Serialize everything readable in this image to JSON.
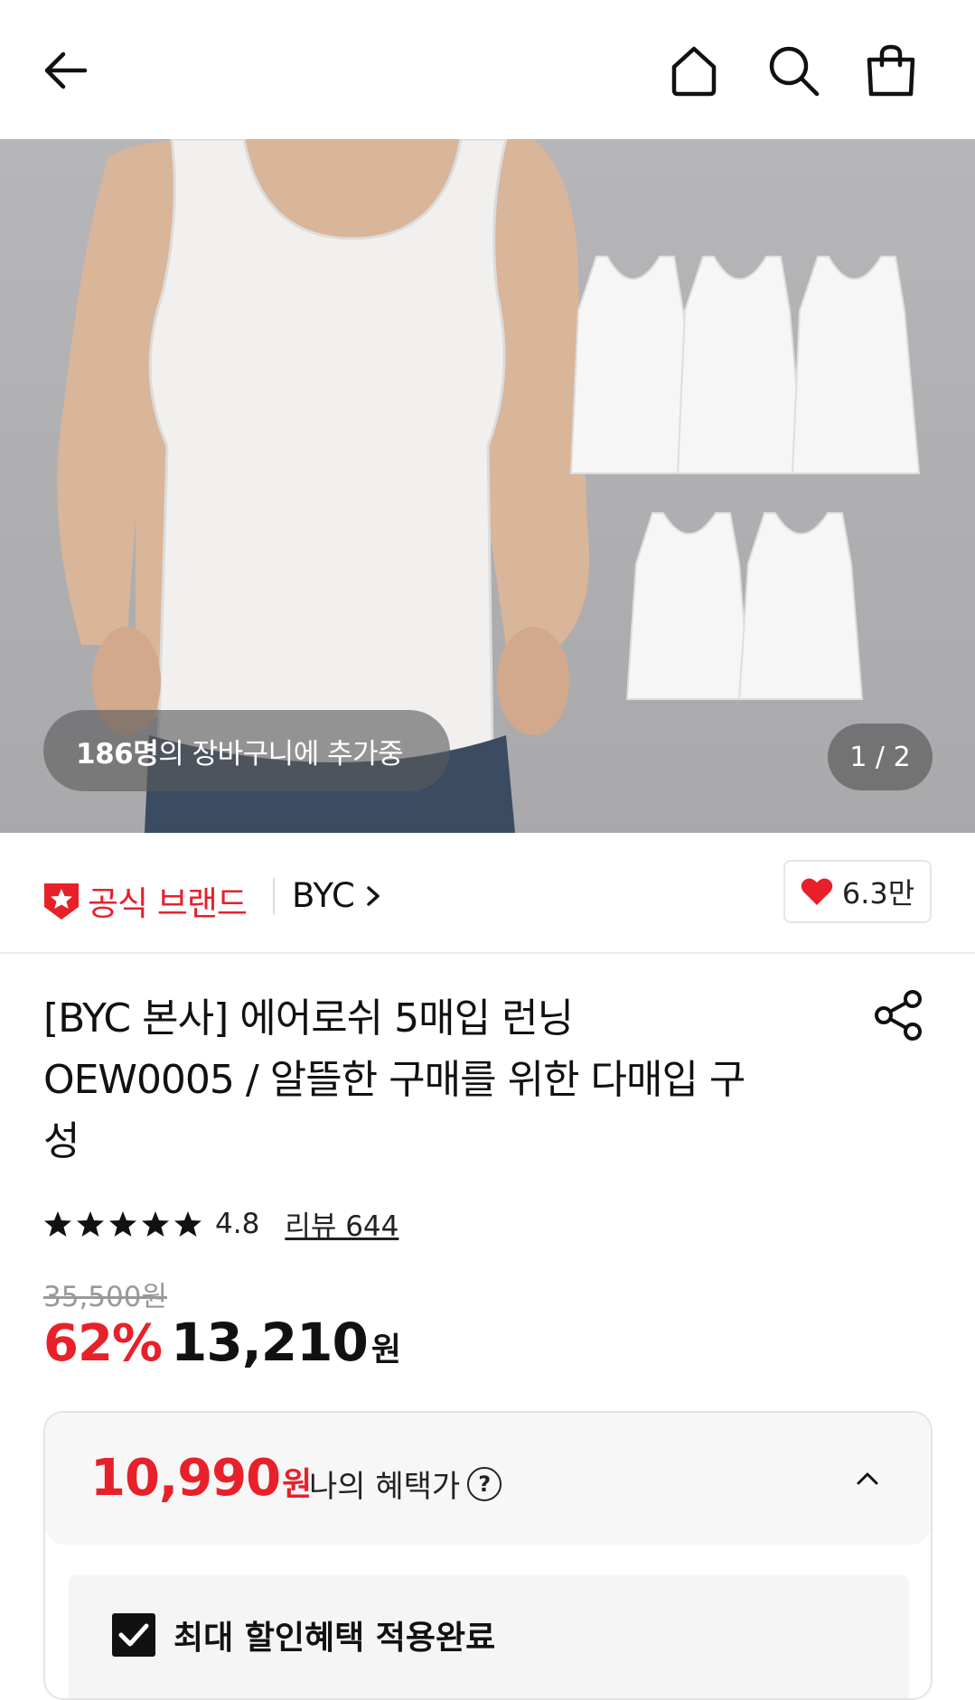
{
  "header": {
    "back_icon": "arrow-left-icon",
    "home_icon": "home-icon",
    "search_icon": "search-icon",
    "cart_icon": "shopping-bag-icon"
  },
  "hero": {
    "cart_count_bold": "186명",
    "cart_count_rest": "의 장바구니에 추가중",
    "image_counter": "1 / 2"
  },
  "brand": {
    "official_label": "공식 브랜드",
    "brand_name": "BYC",
    "likes": "6.3만"
  },
  "product": {
    "title_line1": "[BYC 본사] 에어로쉬 5매입 런닝",
    "title_line2": "OEW0005 / 알뜰한 구매를 위한 다매입 구",
    "title_line3": "성",
    "rating": "4.8",
    "review_label": "리뷰 644",
    "original_price": "35,500원",
    "discount": "62%",
    "price": "13,210",
    "price_unit": "원"
  },
  "benefit": {
    "price": "10,990",
    "price_unit": "원",
    "label": "나의 혜택가",
    "help_symbol": "?",
    "applied_label": "최대 할인혜택 적용완료"
  },
  "colors": {
    "accent_red": "#e8202a",
    "text": "#111111"
  }
}
